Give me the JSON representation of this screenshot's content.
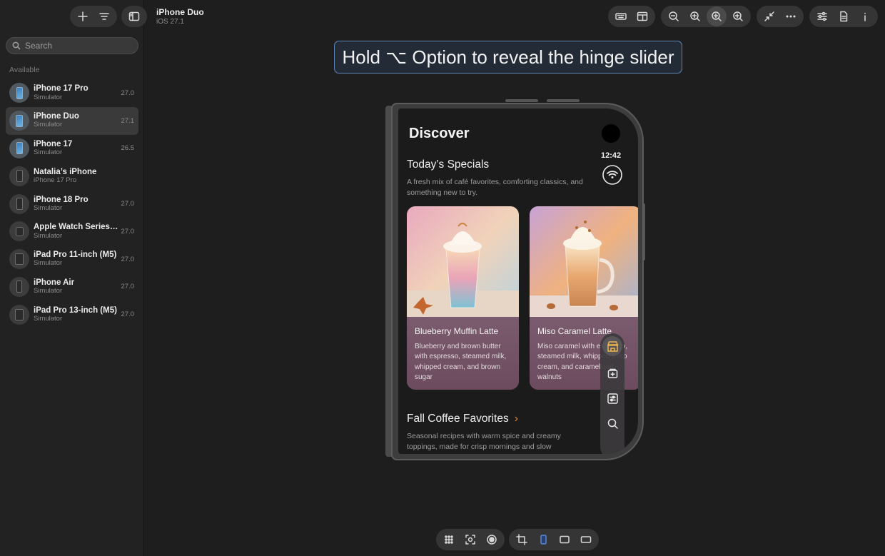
{
  "sidebar": {
    "search_placeholder": "Search",
    "section_label": "Available",
    "devices": [
      {
        "name": "iPhone 17 Pro",
        "sub": "Simulator",
        "version": "27.0"
      },
      {
        "name": "iPhone Duo",
        "sub": "Simulator",
        "version": "27.1"
      },
      {
        "name": "iPhone 17",
        "sub": "Simulator",
        "version": "26.5"
      },
      {
        "name": "Natalia’s iPhone",
        "sub": "iPhone 17 Pro",
        "version": ""
      },
      {
        "name": "iPhone 18 Pro",
        "sub": "Simulator",
        "version": "27.0"
      },
      {
        "name": "Apple Watch Series…",
        "sub": "Simulator",
        "version": "27.0"
      },
      {
        "name": "iPad Pro 11-inch (M5)",
        "sub": "Simulator",
        "version": "27.0"
      },
      {
        "name": "iPhone Air",
        "sub": "Simulator",
        "version": "27.0"
      },
      {
        "name": "iPad Pro 13-inch (M5)",
        "sub": "Simulator",
        "version": "27.0"
      }
    ]
  },
  "header": {
    "title": "iPhone Duo",
    "subtitle": "iOS 27.1"
  },
  "hint": {
    "text": "Hold ⌥ Option to reveal the hinge slider"
  },
  "screen": {
    "title": "Discover",
    "clock": "12:42",
    "section1_title": "Today’s Specials",
    "section1_desc": "A fresh mix of café favorites, comforting classics, and something new to try.",
    "cards": [
      {
        "title": "Blueberry Muffin Latte",
        "desc": "Blueberry and brown butter with espresso, steamed milk, whipped cream, and brown sugar"
      },
      {
        "title": "Miso Caramel Latte",
        "desc": "Miso caramel with espresso, steamed milk, whipped miso cream, and caramelized walnuts"
      }
    ],
    "section2_title": "Fall Coffee Favorites",
    "section2_desc": "Seasonal recipes with warm spice and creamy toppings, made for crisp mornings and slow",
    "accent_color": "#e38a3c"
  },
  "colors": {
    "window_bg": "#1f1e1e",
    "sidebar_bg": "#232222",
    "hint_border": "#5b86b8"
  }
}
